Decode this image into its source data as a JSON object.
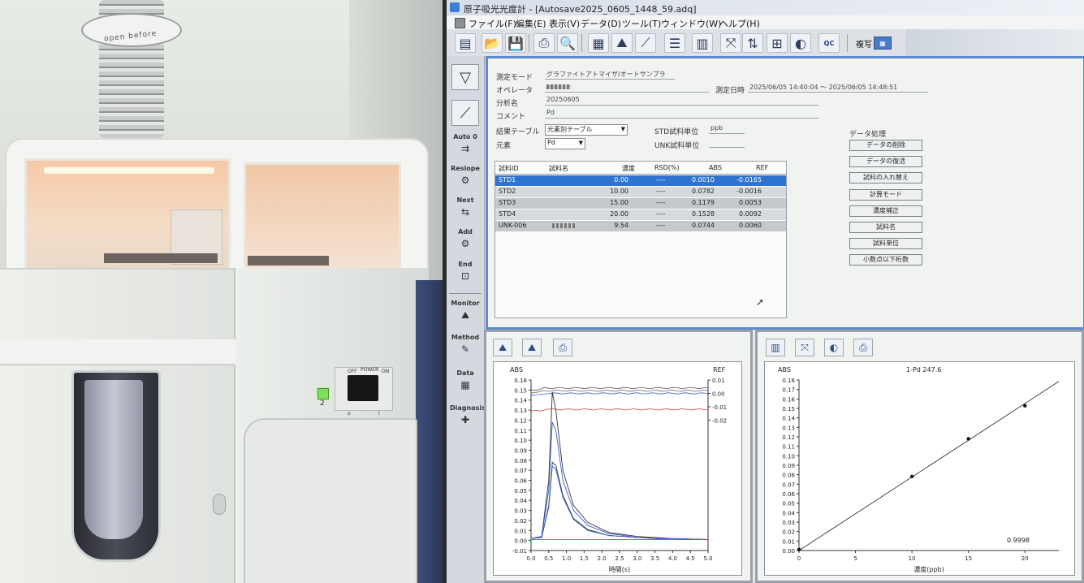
{
  "photo": {
    "duct_sticker": "open  before",
    "power_off": "OFF",
    "power_label": "POWER",
    "power_on": "ON",
    "led_number": "2",
    "switch_off_mark": "o",
    "switch_on_mark": "l"
  },
  "window": {
    "title": "原子吸光光度計 - [Autosave2025_0605_1448_59.adq]"
  },
  "menu": [
    "ファイル(F)",
    "編集(E)",
    "表示(V)",
    "データ(D)",
    "ツール(T)",
    "ウィンドウ(W)",
    "ヘルプ(H)"
  ],
  "toolbar": {
    "icons": [
      "new-icon",
      "open-icon",
      "save-icon",
      "print-icon",
      "preview-icon",
      "table-icon",
      "chart-icon",
      "chart2-icon",
      "list-icon",
      "report-icon",
      "zoom-icon",
      "move-icon",
      "grid-icon",
      "stat-icon",
      "qc-icon"
    ],
    "qc_label": "QC",
    "copy_label": "複写"
  },
  "sidebar": [
    {
      "name": "start",
      "label": ""
    },
    {
      "name": "run",
      "label": ""
    },
    {
      "name": "auto-zero",
      "label": "Auto 0"
    },
    {
      "name": "reslope",
      "label": "Reslope"
    },
    {
      "name": "next",
      "label": "Next"
    },
    {
      "name": "add",
      "label": "Add"
    },
    {
      "name": "end",
      "label": "End"
    },
    {
      "name": "monitor",
      "label": "Monitor"
    },
    {
      "name": "method",
      "label": "Method"
    },
    {
      "name": "data",
      "label": "Data"
    },
    {
      "name": "diagnosis",
      "label": "Diagnosis"
    }
  ],
  "info": {
    "mode_label": "測定モード",
    "mode_value": "グラファイトアトマイザ/オートサンプラ",
    "operator_label": "オペレータ",
    "datetime_label": "測定日時",
    "datetime_value": "2025/06/05 14:40:04 ～ 2025/06/05 14:48:51",
    "analysis_label": "分析名",
    "analysis_value": "20250605",
    "comment_label": "コメント",
    "comment_value": "Pd",
    "result_table_label": "結果テーブル",
    "result_table_value": "元素別テーブル",
    "element_label": "元素",
    "element_value": "Pd",
    "std_unit_label": "STD試料単位",
    "std_unit_value": "ppb",
    "unk_unit_label": "UNK試料単位",
    "unk_unit_value": ""
  },
  "table": {
    "headers": [
      "試料ID",
      "試料名",
      "濃度",
      "RSD(%)",
      "ABS",
      "REF"
    ],
    "rows": [
      {
        "id": "STD1",
        "name": "",
        "conc": "0.00",
        "rsd": "----",
        "abs": "0.0010",
        "ref": "-0.0165"
      },
      {
        "id": "STD2",
        "name": "",
        "conc": "10.00",
        "rsd": "----",
        "abs": "0.0782",
        "ref": "-0.0016"
      },
      {
        "id": "STD3",
        "name": "",
        "conc": "15.00",
        "rsd": "----",
        "abs": "0.1179",
        "ref": "0.0053"
      },
      {
        "id": "STD4",
        "name": "",
        "conc": "20.00",
        "rsd": "----",
        "abs": "0.1528",
        "ref": "0.0092"
      },
      {
        "id": "UNK-006",
        "name": "",
        "conc": "9.54",
        "rsd": "----",
        "abs": "0.0744",
        "ref": "0.0060"
      }
    ]
  },
  "data_processing": {
    "title": "データ処理",
    "buttons": [
      "データの削除",
      "データの復活",
      "試料の入れ替え",
      "計算モード",
      "濃度補正",
      "試料名",
      "試料単位",
      "小数点以下桁数"
    ]
  },
  "peak_chart": {
    "y_label": "ABS",
    "ref_label": "REF",
    "x_label": "時間(s)",
    "y_ticks": [
      "0.16",
      "0.15",
      "0.14",
      "0.13",
      "0.12",
      "0.11",
      "0.10",
      "0.09",
      "0.08",
      "0.07",
      "0.06",
      "0.05",
      "0.04",
      "0.03",
      "0.02",
      "0.01",
      "0.00",
      "-0.01"
    ],
    "ref_ticks": [
      "0.01",
      "0.00",
      "-0.01",
      "-0.02"
    ],
    "x_ticks": [
      "0.0",
      "0.5",
      "1.0",
      "1.5",
      "2.0",
      "2.5",
      "3.0",
      "3.5",
      "4.0",
      "4.5",
      "5.0"
    ]
  },
  "cal_chart": {
    "y_label": "ABS",
    "title": "1-Pd 247.6",
    "x_label": "濃度(ppb)",
    "r_value": "0.9998",
    "y_ticks": [
      "0.18",
      "0.17",
      "0.16",
      "0.15",
      "0.14",
      "0.13",
      "0.12",
      "0.11",
      "0.10",
      "0.09",
      "0.08",
      "0.07",
      "0.06",
      "0.05",
      "0.04",
      "0.03",
      "0.02",
      "0.01",
      "0.00"
    ],
    "x_ticks": [
      "0",
      "5",
      "10",
      "15",
      "20"
    ]
  },
  "chart_data": [
    {
      "type": "line",
      "title": "",
      "xlabel": "時間(s)",
      "ylabel": "ABS",
      "xlim": [
        0,
        5
      ],
      "ylim": [
        -0.01,
        0.16
      ],
      "series": [
        {
          "x": [
            0.0,
            0.3,
            0.5,
            0.6,
            0.7,
            0.9,
            1.2,
            1.6,
            2.2,
            3.0,
            4.0,
            5.0
          ],
          "y": [
            0.002,
            0.004,
            0.06,
            0.148,
            0.13,
            0.07,
            0.035,
            0.018,
            0.008,
            0.004,
            0.002,
            0.001
          ]
        },
        {
          "x": [
            0.0,
            0.3,
            0.5,
            0.6,
            0.7,
            0.9,
            1.2,
            1.6,
            2.2,
            3.0,
            4.0,
            5.0
          ],
          "y": [
            0.002,
            0.004,
            0.05,
            0.118,
            0.11,
            0.06,
            0.03,
            0.015,
            0.007,
            0.003,
            0.002,
            0.001
          ]
        },
        {
          "x": [
            0.0,
            0.3,
            0.5,
            0.6,
            0.7,
            0.9,
            1.2,
            1.6,
            2.2,
            3.0,
            4.0,
            5.0
          ],
          "y": [
            0.002,
            0.003,
            0.035,
            0.078,
            0.075,
            0.045,
            0.022,
            0.011,
            0.005,
            0.003,
            0.001,
            0.001
          ]
        },
        {
          "x": [
            0.0,
            0.3,
            0.5,
            0.6,
            0.7,
            0.9,
            1.2,
            1.6,
            2.2,
            3.0,
            4.0,
            5.0
          ],
          "y": [
            0.002,
            0.003,
            0.033,
            0.074,
            0.071,
            0.043,
            0.021,
            0.01,
            0.005,
            0.003,
            0.001,
            0.001
          ]
        },
        {
          "x": [
            0.0,
            5.0
          ],
          "y": [
            0.001,
            0.001
          ]
        }
      ]
    },
    {
      "type": "scatter",
      "title": "1-Pd 247.6",
      "xlabel": "濃度(ppb)",
      "ylabel": "ABS",
      "xlim": [
        0,
        23
      ],
      "ylim": [
        0,
        0.18
      ],
      "points": [
        {
          "x": 0,
          "y": 0.001
        },
        {
          "x": 10,
          "y": 0.0782
        },
        {
          "x": 15,
          "y": 0.1179
        },
        {
          "x": 20,
          "y": 0.1528
        }
      ],
      "fit": {
        "x": [
          0,
          23
        ],
        "y": [
          0.0,
          0.1785
        ]
      },
      "r": "0.9998"
    }
  ]
}
